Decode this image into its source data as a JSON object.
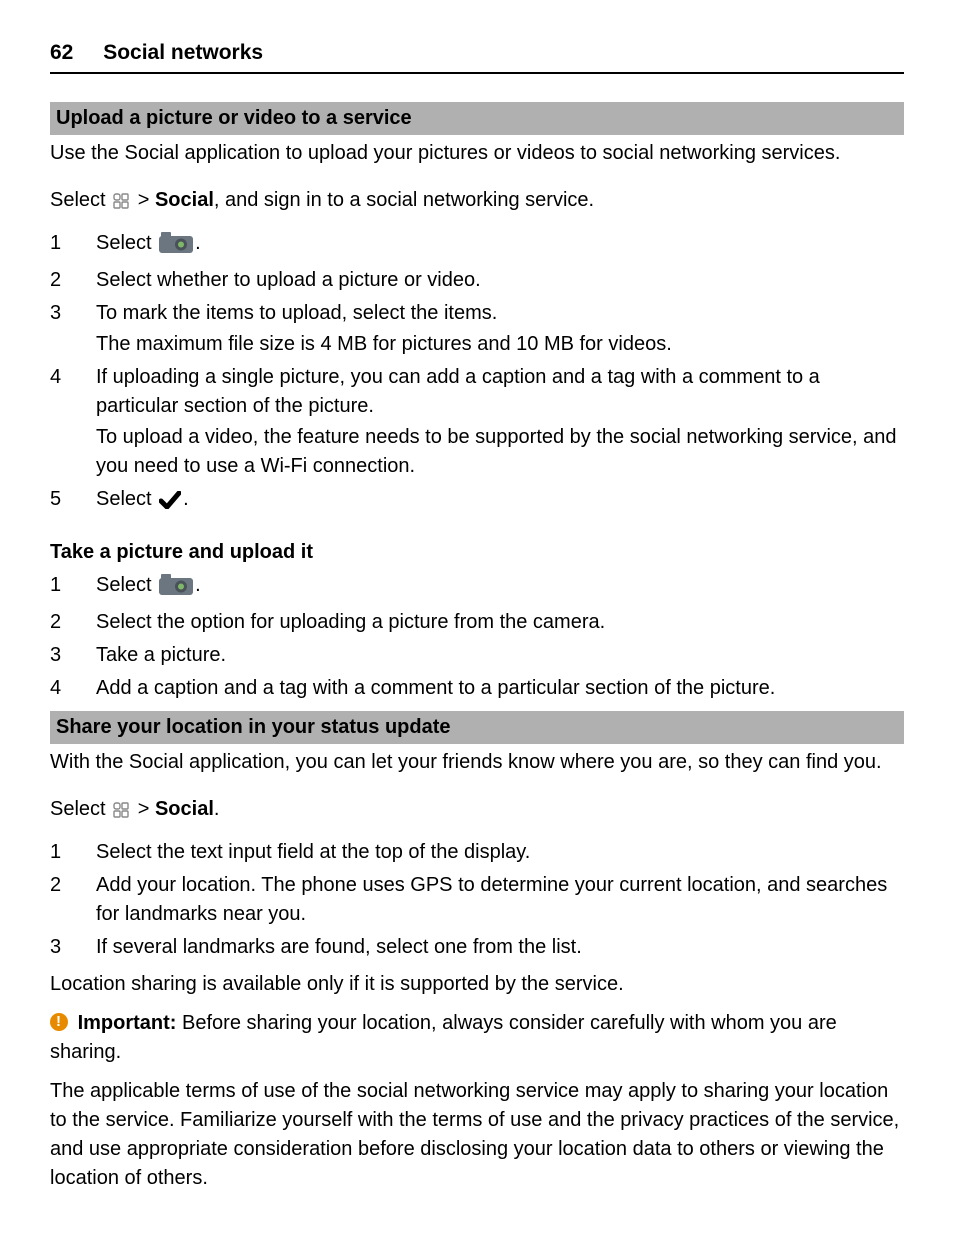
{
  "header": {
    "pageNumber": "62",
    "chapter": "Social networks"
  },
  "section1": {
    "title": "Upload a picture or video to a service",
    "intro": "Use the Social application to upload your pictures or videos to social networking services.",
    "selectLine": {
      "pre": "Select ",
      "post1": " > ",
      "bold": "Social",
      "post2": ", and sign in to a social networking service."
    },
    "steps": [
      {
        "pre": "Select ",
        "iconAfter": true,
        "post": "."
      },
      {
        "text": "Select whether to upload a picture or video."
      },
      {
        "text": "To mark the items to upload, select the items.",
        "sub": "The maximum file size is 4 MB for pictures and 10 MB for videos."
      },
      {
        "text": "If uploading a single picture, you can add a caption and a tag with a comment to a particular section of the picture.",
        "sub": "To upload a video, the feature needs to be supported by the social networking service, and you need to use a Wi-Fi connection."
      },
      {
        "pre": "Select ",
        "iconCheck": true,
        "post": "."
      }
    ]
  },
  "section2": {
    "heading": "Take a picture and upload it",
    "steps": [
      {
        "pre": "Select ",
        "iconAfter": true,
        "post": "."
      },
      {
        "text": "Select the option for uploading a picture from the camera."
      },
      {
        "text": "Take a picture."
      },
      {
        "text": "Add a caption and a tag with a comment to a particular section of the picture."
      }
    ]
  },
  "section3": {
    "title": "Share your location in your status update",
    "intro": "With the Social application, you can let your friends know where you are, so they can find you.",
    "selectLine": {
      "pre": "Select ",
      "post1": " > ",
      "bold": "Social",
      "post2": "."
    },
    "steps": [
      {
        "text": "Select the text input field at the top of the display."
      },
      {
        "text": "Add your location. The phone uses GPS to determine your current location, and searches for landmarks near you."
      },
      {
        "text": "If several landmarks are found, select one from the list."
      }
    ],
    "note": "Location sharing is available only if it is supported by the service.",
    "important": {
      "label": "Important:",
      "text": " Before sharing your location, always consider carefully with whom you are sharing."
    },
    "terms": "The applicable terms of use of the social networking service may apply to sharing your location to the service. Familiarize yourself with the terms of use and the privacy practices of the service, and use appropriate consideration before disclosing your location data to others or viewing the location of others."
  }
}
